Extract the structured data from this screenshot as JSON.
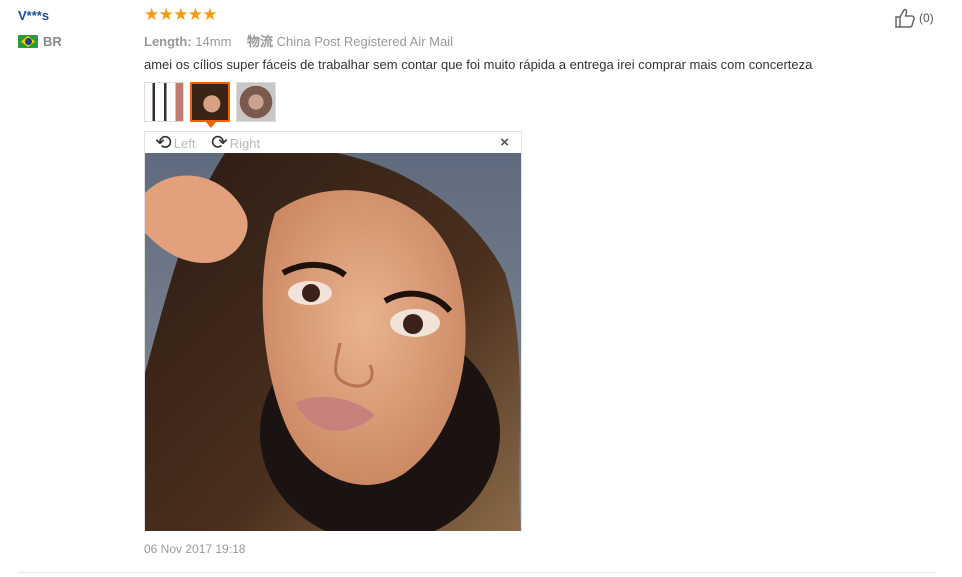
{
  "review": {
    "user": "V***s",
    "country": "BR",
    "rating": 5,
    "length_label": "Length:",
    "length_value": "14mm",
    "shipping_label": "物流",
    "shipping_value": "China Post Registered Air Mail",
    "text": "amei os cílios super fáceis de trabalhar sem contar que foi muito rápida a entrega irei comprar mais com concerteza",
    "date": "06 Nov 2017 19:18",
    "helpful_count": "(0)"
  },
  "viewer": {
    "rotate_left_label": "Left",
    "rotate_right_label": "Right",
    "close_symbol": "×"
  },
  "icons": {
    "flag": "brazil-flag-icon",
    "thumbs_up": "thumbs-up-icon",
    "star": "star-icon"
  },
  "colors": {
    "star": "#f59a13",
    "username": "#1a4ea1",
    "active_thumb": "#f06100"
  }
}
